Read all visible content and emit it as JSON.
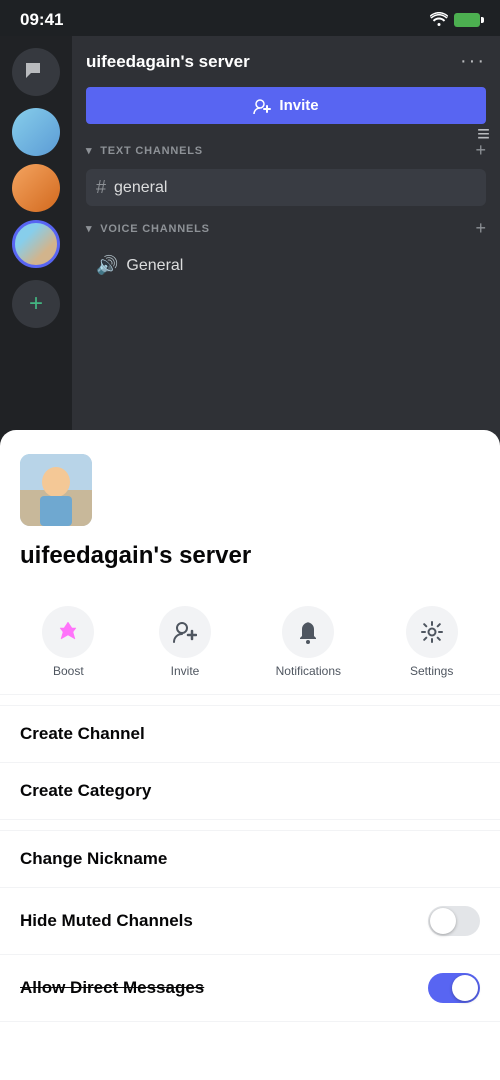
{
  "statusBar": {
    "time": "09:41"
  },
  "sidebar": {
    "addLabel": "+"
  },
  "serverPanel": {
    "name": "uifeedagain's server",
    "inviteButton": "Invite",
    "textChannelsLabel": "TEXT CHANNELS",
    "voiceChannelsLabel": "VOICE CHANNELS",
    "generalChannel": "general",
    "generalVoice": "General"
  },
  "bottomSheet": {
    "serverName": "uifeedagain's server",
    "actions": [
      {
        "id": "boost",
        "label": "Boost"
      },
      {
        "id": "invite",
        "label": "Invite"
      },
      {
        "id": "notifications",
        "label": "Notifications"
      },
      {
        "id": "settings",
        "label": "Settings"
      }
    ],
    "menuSection1": [
      {
        "id": "create-channel",
        "label": "Create Channel"
      },
      {
        "id": "create-category",
        "label": "Create Category"
      }
    ],
    "toggleSection": [
      {
        "id": "change-nickname",
        "label": "Change Nickname",
        "hasToggle": false
      },
      {
        "id": "hide-muted",
        "label": "Hide Muted Channels",
        "hasToggle": true,
        "toggleState": "off"
      },
      {
        "id": "allow-direct",
        "label": "Allow Direct Messages",
        "hasToggle": true,
        "toggleState": "on",
        "strikethrough": true
      }
    ]
  }
}
